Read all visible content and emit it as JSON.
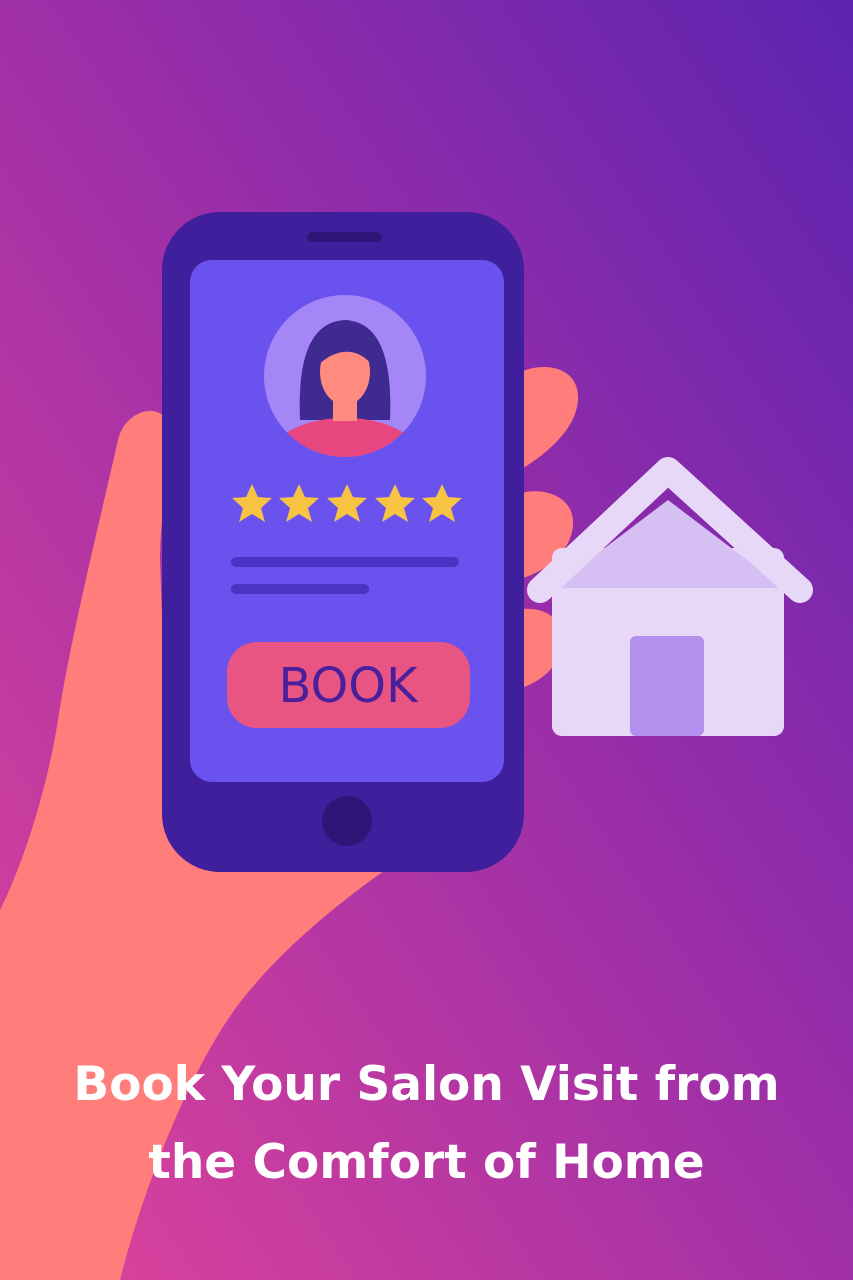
{
  "phone": {
    "book_button_label": "BOOK",
    "rating_stars": 5,
    "rating_max": 5
  },
  "headline": {
    "line1": "Book Your Salon Visit from",
    "line2": "the Comfort of Home"
  },
  "colors": {
    "background_top": "#5c24b0",
    "background_bottom": "#e0449a",
    "phone_body": "#3f1f9b",
    "phone_screen": "#6a52ee",
    "book_button": "#e85582",
    "book_text": "#4a1f9c",
    "star": "#f6c343",
    "hand": "#ff7b7b",
    "house_wall": "#e8d8f8",
    "house_roof": "#d6bff3",
    "house_door": "#b490ee",
    "avatar_bg": "#a586f7",
    "avatar_hair": "#3f2a8f",
    "avatar_shirt": "#e8467f",
    "headline_text": "#ffffff"
  },
  "icons": {
    "avatar": "woman-avatar-icon",
    "star": "star-icon",
    "house": "house-icon",
    "hand": "hand-illustration"
  }
}
